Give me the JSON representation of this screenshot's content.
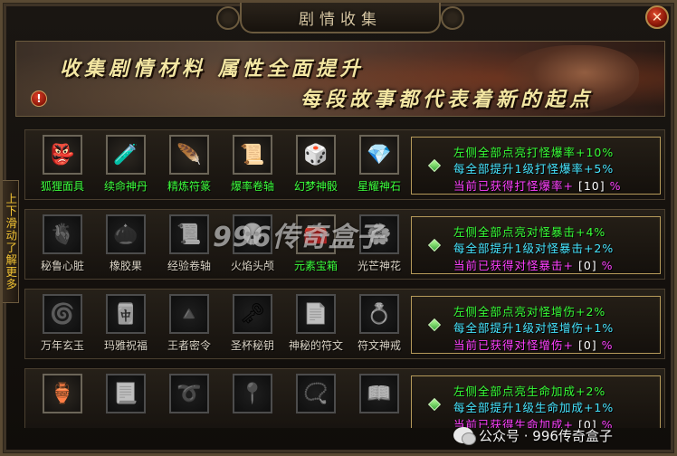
{
  "window": {
    "title": "剧情收集",
    "close_label": "✕"
  },
  "banner": {
    "line1": "收集剧情材料  属性全面提升",
    "line2": "每段故事都代表着新的起点",
    "info_label": "!"
  },
  "side_tab": {
    "label": "上下滑动了解更多"
  },
  "watermark": "996传奇盒子",
  "footer_watermark": "公众号 · 996传奇盒子",
  "rows": [
    {
      "items": [
        {
          "label": "狐狸面具",
          "icon": "fox-mask-icon",
          "glyph": "👺",
          "lit": true
        },
        {
          "label": "续命神丹",
          "icon": "potion-icon",
          "glyph": "🧪",
          "lit": true
        },
        {
          "label": "精炼符篆",
          "icon": "talisman-feather-icon",
          "glyph": "🪶",
          "lit": true
        },
        {
          "label": "爆率卷轴",
          "icon": "scroll-icon",
          "glyph": "📜",
          "lit": true
        },
        {
          "label": "幻梦神骰",
          "icon": "dice-icon",
          "glyph": "🎲",
          "lit": true
        },
        {
          "label": "星耀神石",
          "icon": "crystal-icon",
          "glyph": "💎",
          "lit": true
        }
      ],
      "bonus": {
        "line1": "左侧全部点亮打怪爆率+10%",
        "line2": "每全部提升1级打怪爆率+5%",
        "line3_prefix": "当前已获得打怪爆率+",
        "line3_value": "[10]",
        "line3_suffix": "%"
      }
    },
    {
      "items": [
        {
          "label": "秘鲁心脏",
          "icon": "heart-icon",
          "glyph": "🫀",
          "lit": false
        },
        {
          "label": "橡胶果",
          "icon": "rubber-fruit-icon",
          "glyph": "🌰",
          "lit": false
        },
        {
          "label": "经验卷轴",
          "icon": "exp-scroll-icon",
          "glyph": "📜",
          "lit": false
        },
        {
          "label": "火焰头颅",
          "icon": "flame-skull-icon",
          "glyph": "💀",
          "lit": false
        },
        {
          "label": "元素宝箱",
          "icon": "treasure-chest-icon",
          "glyph": "🧰",
          "lit": true
        },
        {
          "label": "光芒神花",
          "icon": "radiant-flower-icon",
          "glyph": "🌸",
          "lit": false
        }
      ],
      "bonus": {
        "line1": "左侧全部点亮对怪暴击+4%",
        "line2": "每全部提升1级对怪暴击+2%",
        "line3_prefix": "当前已获得对怪暴击+",
        "line3_value": "[0]",
        "line3_suffix": "%"
      }
    },
    {
      "items": [
        {
          "label": "万年玄玉",
          "icon": "jade-icon",
          "glyph": "🌀",
          "lit": false
        },
        {
          "label": "玛雅祝福",
          "icon": "maya-tile-icon",
          "glyph": "🀄",
          "lit": false
        },
        {
          "label": "王者密令",
          "icon": "eye-pyramid-icon",
          "glyph": "🔺",
          "lit": false
        },
        {
          "label": "圣杯秘钥",
          "icon": "key-icon",
          "glyph": "🗝",
          "lit": false
        },
        {
          "label": "神秘的符文",
          "icon": "rune-icon",
          "glyph": "📄",
          "lit": false
        },
        {
          "label": "符文神戒",
          "icon": "ring-icon",
          "glyph": "💍",
          "lit": false
        }
      ],
      "bonus": {
        "line1": "左侧全部点亮对怪增伤+2%",
        "line2": "每全部提升1级对怪增伤+1%",
        "line3_prefix": "当前已获得对怪增伤+",
        "line3_value": "[0]",
        "line3_suffix": "%"
      }
    },
    {
      "items": [
        {
          "label": "",
          "icon": "gourd-icon",
          "glyph": "🏺",
          "lit": true
        },
        {
          "label": "",
          "icon": "paper-charm-icon",
          "glyph": "📃",
          "lit": false
        },
        {
          "label": "",
          "icon": "whip-icon",
          "glyph": "➰",
          "lit": false
        },
        {
          "label": "",
          "icon": "needle-icon",
          "glyph": "📍",
          "lit": false
        },
        {
          "label": "",
          "icon": "amulet-icon",
          "glyph": "📿",
          "lit": false
        },
        {
          "label": "",
          "icon": "book-icon",
          "glyph": "📖",
          "lit": false
        }
      ],
      "bonus": {
        "line1": "左侧全部点亮生命加成+2%",
        "line2": "每全部提升1级生命加成+1%",
        "line3_prefix": "当前已获得生命加成+",
        "line3_value": "[0]",
        "line3_suffix": "%"
      }
    }
  ]
}
